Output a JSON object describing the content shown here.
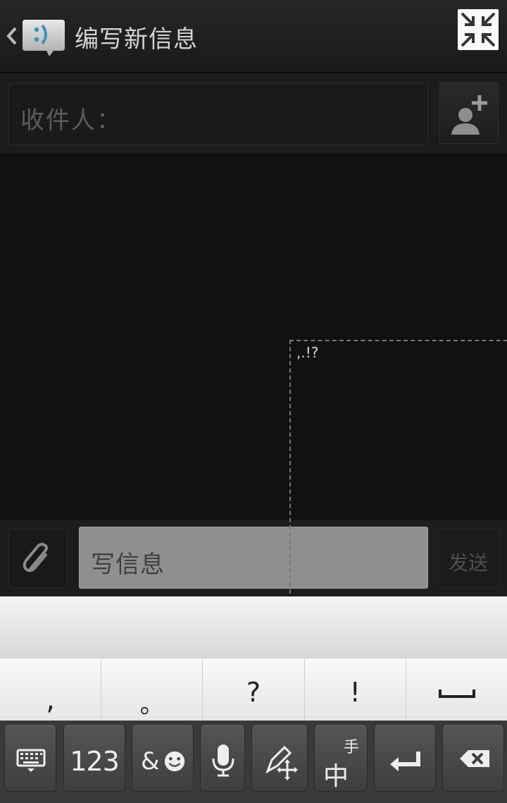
{
  "header": {
    "title": "编写新信息"
  },
  "recipients": {
    "placeholder": "收件人："
  },
  "handwriting": {
    "hint": ",.!?"
  },
  "compose": {
    "placeholder": "写信息",
    "send_label": "发送"
  },
  "keyboard": {
    "punctuation": [
      ",",
      "。",
      "?",
      "!",
      "␣"
    ],
    "num_label": "123",
    "symbol_label": "&",
    "ime_label": "中",
    "ime_sub_label": "手"
  },
  "colors": {
    "background": "#111111",
    "accent_icon": "#3f8fb8"
  }
}
